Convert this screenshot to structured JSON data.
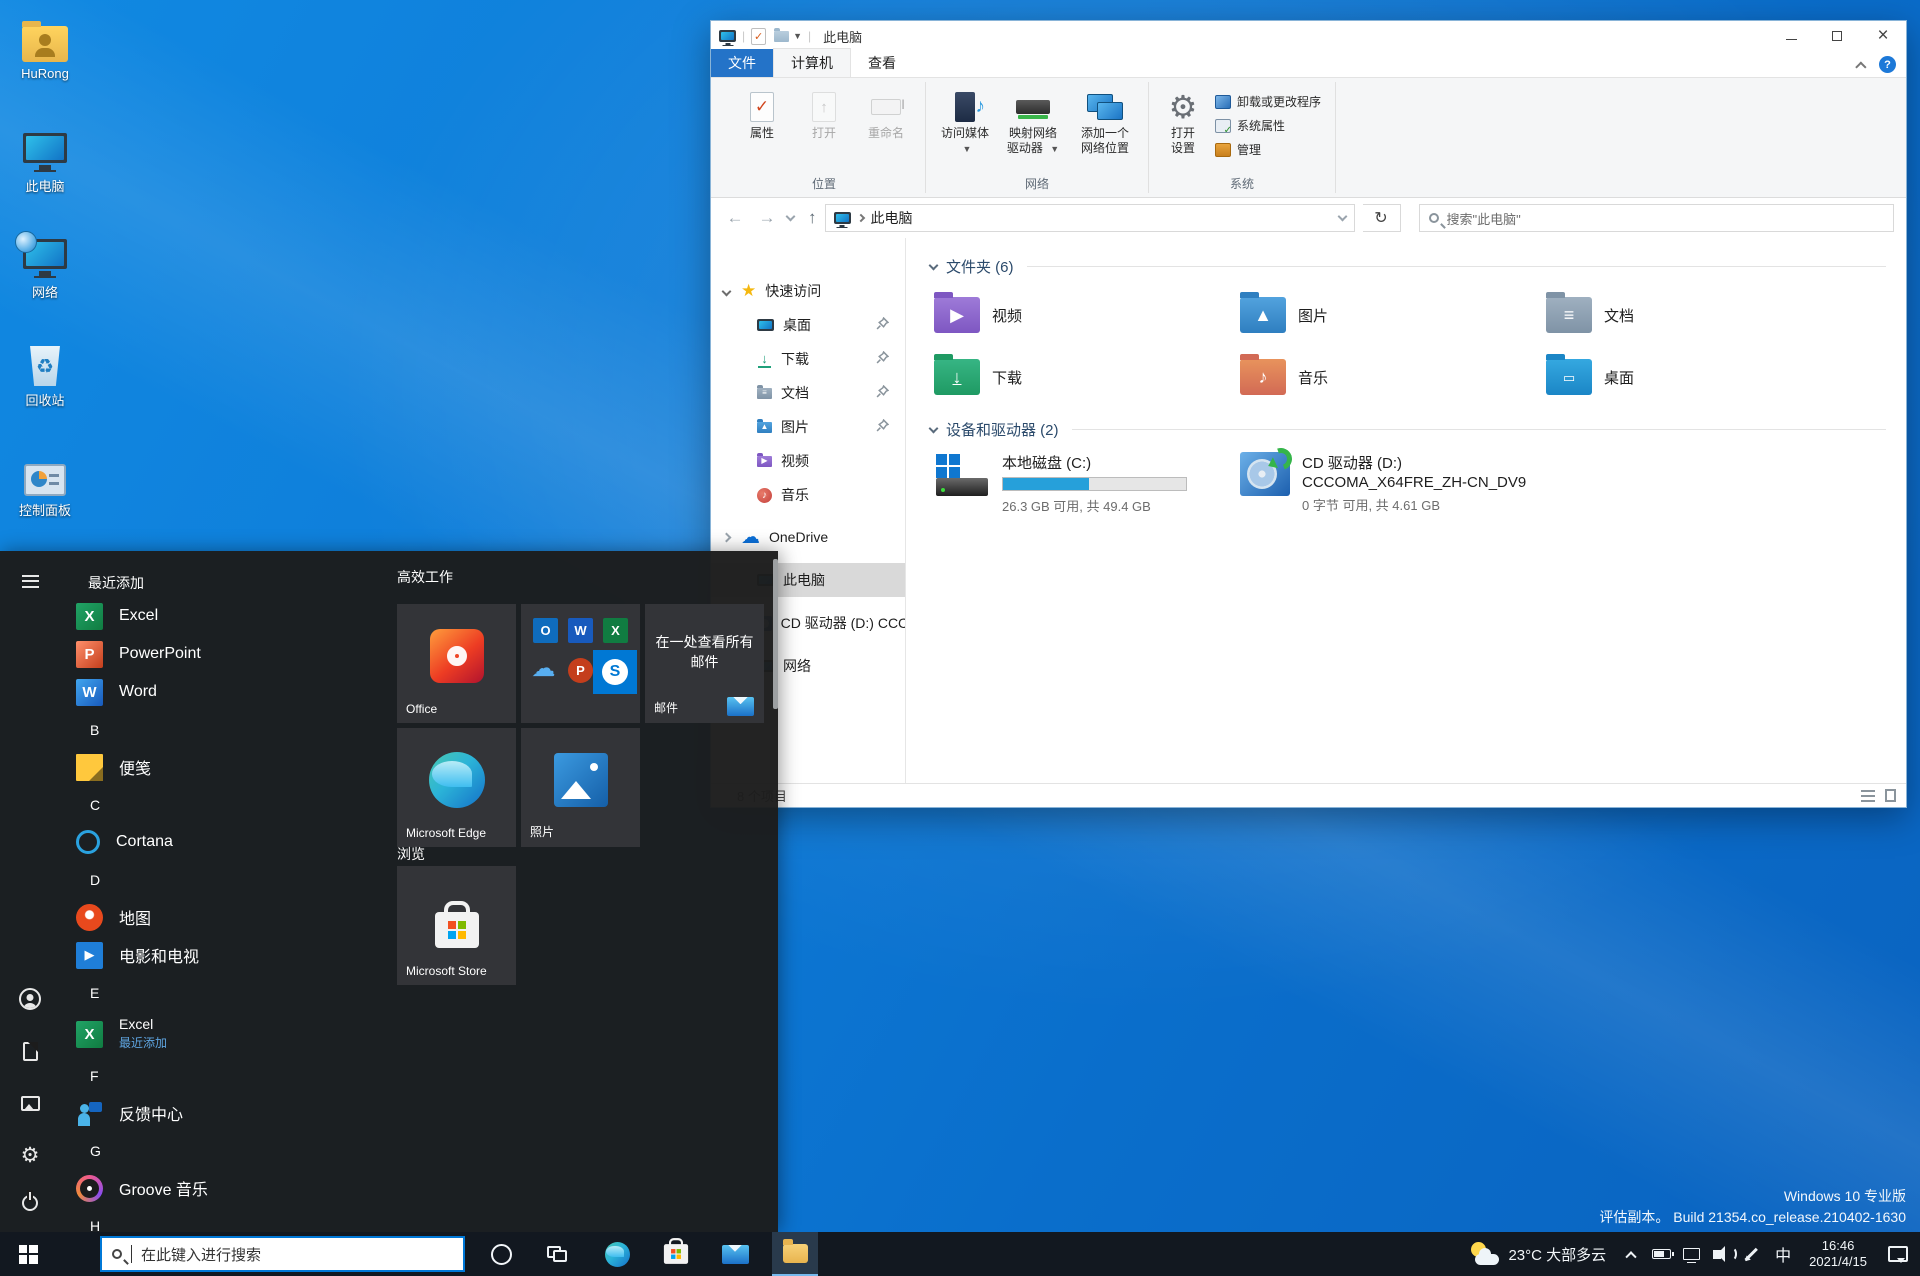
{
  "desktop": {
    "icons": [
      {
        "label": "HuRong"
      },
      {
        "label": "此电脑"
      },
      {
        "label": "网络"
      },
      {
        "label": "回收站"
      },
      {
        "label": "控制面板"
      }
    ],
    "watermark": {
      "line1": "Windows 10 专业版",
      "line2": "评估副本。  Build 21354.co_release.210402-1630"
    }
  },
  "explorer": {
    "title": "此电脑",
    "tabs": {
      "file": "文件",
      "computer": "计算机",
      "view": "查看"
    },
    "ribbon": {
      "properties": "属性",
      "open": "打开",
      "rename": "重命名",
      "group_location": "位置",
      "access_media": "访问媒体",
      "map_l1": "映射网络",
      "map_l2": "驱动器",
      "add_l1": "添加一个",
      "add_l2": "网络位置",
      "group_network": "网络",
      "settings_l1": "打开",
      "settings_l2": "设置",
      "uninstall": "卸载或更改程序",
      "sysprops": "系统属性",
      "manage": "管理",
      "group_system": "系统"
    },
    "address": {
      "path": "此电脑",
      "search_placeholder": "搜索\"此电脑\""
    },
    "nav": {
      "items": [
        {
          "label": "快速访问"
        },
        {
          "label": "桌面"
        },
        {
          "label": "下载"
        },
        {
          "label": "文档"
        },
        {
          "label": "图片"
        },
        {
          "label": "视频"
        },
        {
          "label": "音乐"
        },
        {
          "label": "OneDrive"
        },
        {
          "label": "此电脑"
        },
        {
          "label": "CD 驱动器 (D:) CCC"
        },
        {
          "label": "网络"
        }
      ]
    },
    "content": {
      "folders_header": "文件夹 (6)",
      "folders": [
        "视频",
        "图片",
        "文档",
        "下载",
        "音乐",
        "桌面"
      ],
      "drives_header": "设备和驱动器 (2)",
      "drive_c": {
        "name": "本地磁盘 (C:)",
        "info": "26.3 GB 可用, 共 49.4 GB",
        "bar_style": "width:47%"
      },
      "drive_d": {
        "name": "CD 驱动器 (D:)",
        "name2": "CCCOMA_X64FRE_ZH-CN_DV9",
        "info": "0 字节 可用, 共 4.61 GB"
      }
    },
    "statusbar": {
      "items": "8 个项目"
    }
  },
  "start": {
    "list": {
      "recent": "最近添加",
      "excel": "Excel",
      "powerpoint": "PowerPoint",
      "word": "Word",
      "sec_b": "B",
      "sticky": "便笺",
      "sec_c": "C",
      "cortana": "Cortana",
      "sec_d": "D",
      "maps": "地图",
      "movies": "电影和电视",
      "sec_e": "E",
      "excel2": "Excel",
      "excel2_sub": "最近添加",
      "sec_f": "F",
      "feedback": "反馈中心",
      "sec_g": "G",
      "groove": "Groove 音乐",
      "sec_h": "H"
    },
    "tiles": {
      "group1": "高效工作",
      "office": "Office",
      "mail_text": "在一处查看所有邮件",
      "mail_label": "邮件",
      "edge": "Microsoft Edge",
      "photos": "照片",
      "group2": "浏览",
      "store": "Microsoft Store"
    }
  },
  "taskbar": {
    "search_placeholder": "在此键入进行搜索",
    "weather": "23°C 大部多云",
    "ime": "中",
    "time": "16:46",
    "date": "2021/4/15"
  }
}
